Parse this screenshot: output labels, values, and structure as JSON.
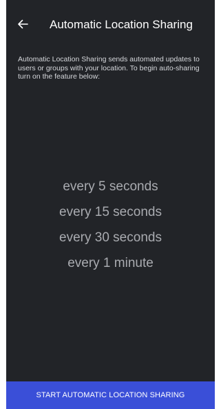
{
  "header": {
    "title": "Automatic Location Sharing",
    "back_icon": "arrow-left-icon"
  },
  "description": "Automatic Location Sharing sends automated updates to users or groups with your location. To begin auto-sharing turn on the feature below:",
  "interval_picker": {
    "options": [
      "every 5 seconds",
      "every 15 seconds",
      "every 30 seconds",
      "every 1 minute"
    ]
  },
  "footer": {
    "start_label": "START AUTOMATIC LOCATION SHARING"
  },
  "colors": {
    "background": "#222428",
    "accent": "#3a4fd8",
    "picker_text": "#a9abb0"
  }
}
